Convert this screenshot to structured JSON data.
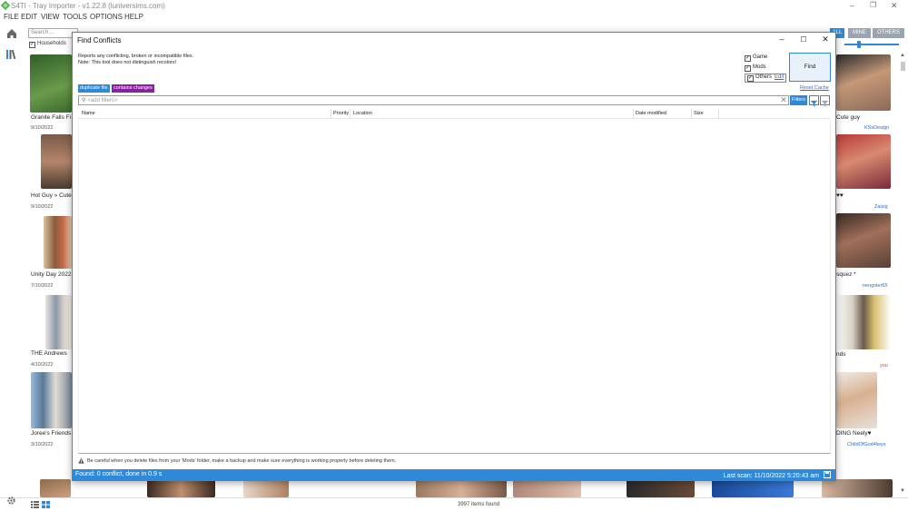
{
  "app": {
    "title": "S4TI - Tray Importer - v1.22.8  (luniversims.com)",
    "menu": [
      "FILE",
      "EDIT",
      "VIEW",
      "TOOLS",
      "OPTIONS",
      "HELP"
    ],
    "search_placeholder": "Search ...",
    "households_label": "Households",
    "filter_tabs": [
      {
        "label": "ALL",
        "active": true
      },
      {
        "label": "MINE",
        "active": false
      },
      {
        "label": "OTHERS",
        "active": false
      }
    ],
    "items_found": "3997 items found",
    "accent_color": "#2e8ad8"
  },
  "gallery_left": [
    {
      "caption": "Granite Falls Fi",
      "date": "9/10/2022"
    },
    {
      "caption": "Hot Guy » Cute",
      "date": "9/10/2022"
    },
    {
      "caption": "Unity Day 2022",
      "date": "7/10/2022"
    },
    {
      "caption": "THE Andrews",
      "date": "4/10/2022"
    },
    {
      "caption": "Joree's Friends",
      "date": "3/10/2022"
    }
  ],
  "gallery_right": [
    {
      "caption": "Cute guy",
      "creator": "KSsDesign"
    },
    {
      "caption": "♥♥",
      "creator": "Zaisig"
    },
    {
      "caption": "squez *",
      "creator": "nengster65"
    },
    {
      "caption": "nds",
      "creator": "you"
    },
    {
      "caption": "DING Neely♥",
      "creator": "ChildOfGod4lwys"
    }
  ],
  "dialog": {
    "title": "Find Conflicts",
    "description_line1": "Reports any conflicting, broken or incompatible files.",
    "description_line2": "Note: This tool does not distinguish recolors!",
    "options": [
      {
        "label": "Game",
        "checked": true
      },
      {
        "label": "Mods",
        "checked": true
      },
      {
        "label": "Others",
        "checked": true
      }
    ],
    "edit_link": "Edit",
    "find_button": "Find",
    "reset_cache": "Reset Cache",
    "tags": [
      {
        "label": "duplicate file",
        "color": "#2e8ad8"
      },
      {
        "label": "contains changes",
        "color": "#8a1fa0"
      }
    ],
    "filter_placeholder": "<add filters>",
    "filters_button": "Filters",
    "columns": [
      "Name",
      "Priority",
      "Location",
      "Date modified",
      "Size"
    ],
    "rows": [],
    "warning": "Be careful when you delete files from your 'Mods' folder, make a backup and make sure everything is working properly before deleting them.",
    "status_left": "Found: 0 conflict, done in 0.9 s",
    "status_right": "Last scan: 11/10/2022 5:20:43 am"
  }
}
